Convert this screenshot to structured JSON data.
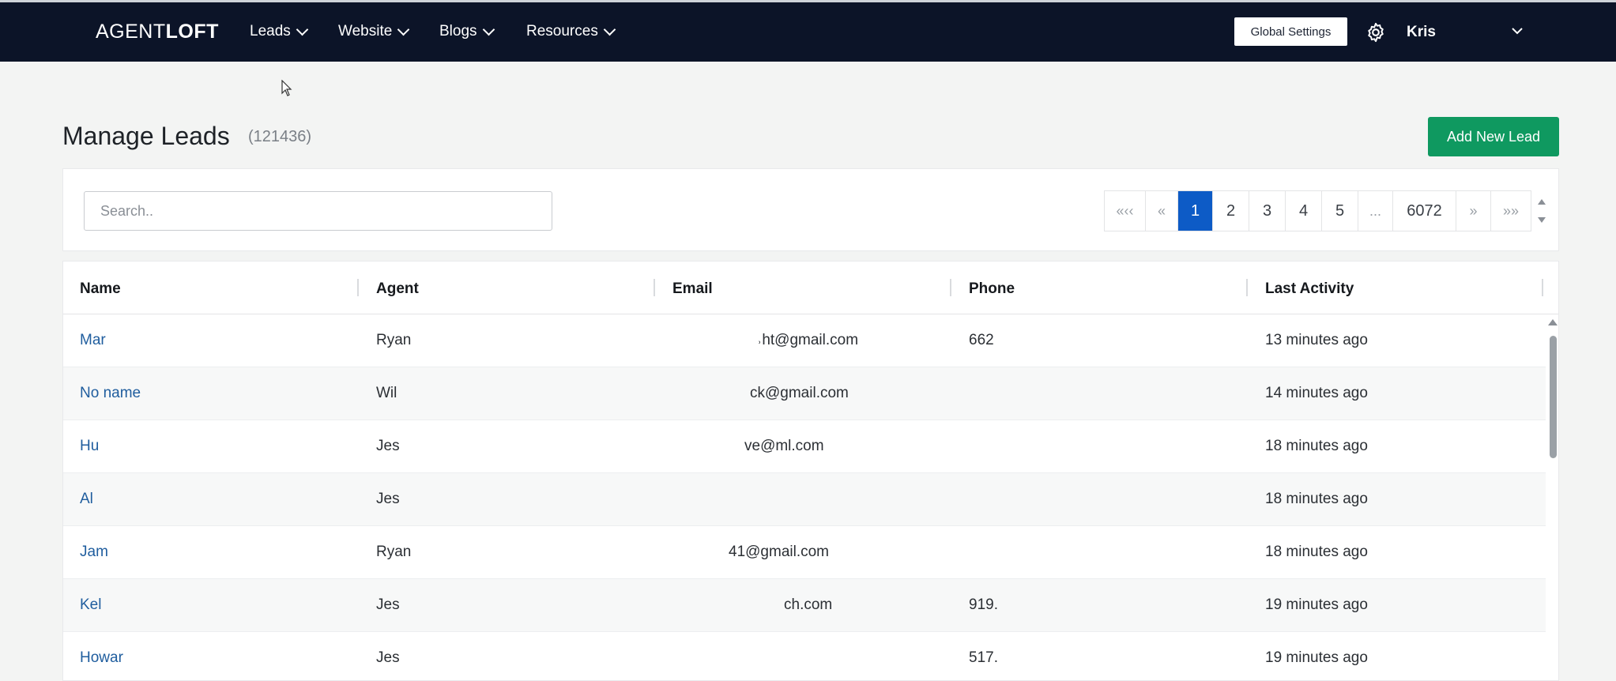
{
  "app": {
    "brand_light": "AGENT",
    "brand_bold": "LOFT"
  },
  "nav": {
    "items": [
      {
        "label": "Leads"
      },
      {
        "label": "Website"
      },
      {
        "label": "Blogs"
      },
      {
        "label": "Resources"
      }
    ],
    "global_settings_label": "Global Settings",
    "settings_icon": "gear-icon",
    "user_name": "Kris"
  },
  "page": {
    "title": "Manage Leads",
    "count": "(121436)",
    "add_button_label": "Add New Lead"
  },
  "search": {
    "placeholder": "Search..",
    "value": ""
  },
  "pagination": {
    "first": "«‹‹",
    "prev": "«",
    "pages": [
      "1",
      "2",
      "3",
      "4",
      "5"
    ],
    "ellipsis": "...",
    "last_page": "6072",
    "next": "»",
    "last": "»»",
    "current": "1"
  },
  "table": {
    "columns": [
      "Name",
      "Agent",
      "Email",
      "Phone",
      "Last Activity"
    ],
    "rows": [
      {
        "name": "Mar",
        "agent": "Ryan",
        "email": "˒ht@gmail.com",
        "phone": "662",
        "activity": "13 minutes ago"
      },
      {
        "name": "No name",
        "agent": "Wil",
        "email": "ck@gmail.com",
        "phone": "",
        "activity": "14 minutes ago"
      },
      {
        "name": "Hu",
        "agent": "Jes",
        "email": "ve@ml.com",
        "phone": "",
        "activity": "18 minutes ago"
      },
      {
        "name": "Al",
        "agent": "Jes",
        "email": "",
        "phone": "",
        "activity": "18 minutes ago"
      },
      {
        "name": "Jam",
        "agent": "Ryan",
        "email": "41@gmail.com",
        "phone": "",
        "activity": "18 minutes ago"
      },
      {
        "name": "Kel",
        "agent": "Jes",
        "email": "ch.com",
        "phone": "919.",
        "activity": "19 minutes ago"
      },
      {
        "name": "Howar",
        "agent": "Jes",
        "email": "",
        "phone": "517.",
        "activity": "19 minutes ago"
      }
    ]
  },
  "colors": {
    "nav_bg": "#0c1428",
    "accent_green": "#0f9960",
    "active_page": "#0d5bc6",
    "link": "#1f5d9e"
  }
}
